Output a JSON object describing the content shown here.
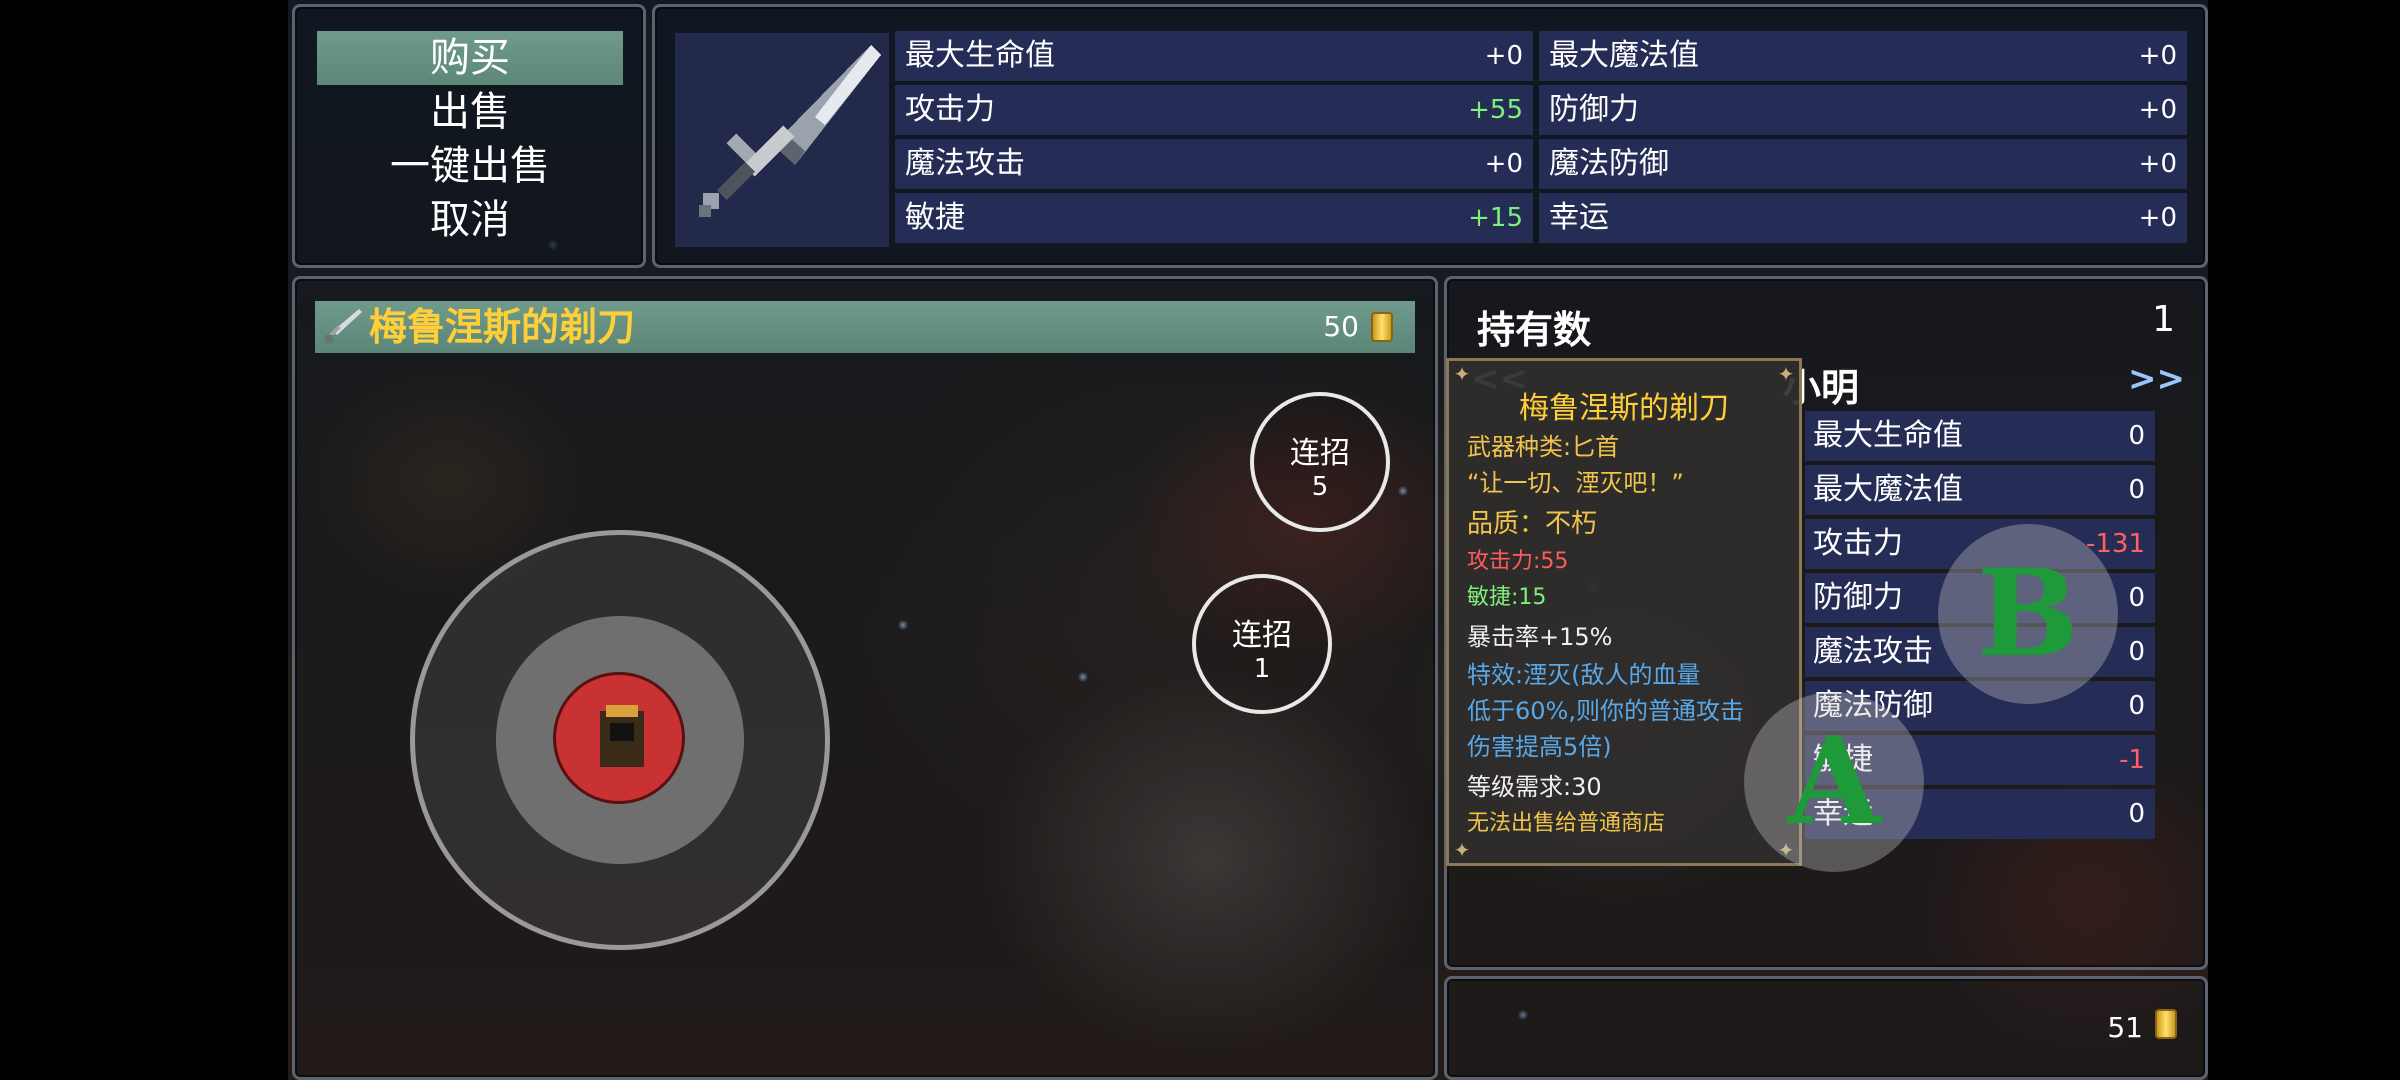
{
  "command_menu": {
    "items": [
      {
        "label": "购买",
        "selected": true
      },
      {
        "label": "出售",
        "selected": false
      },
      {
        "label": "一键出售",
        "selected": false
      },
      {
        "label": "取消",
        "selected": false
      }
    ]
  },
  "item_stats": {
    "icon": "dagger-icon",
    "rows": [
      {
        "label": "最大生命值",
        "value": "+0"
      },
      {
        "label": "最大魔法值",
        "value": "+0"
      },
      {
        "label": "攻击力",
        "value": "+55"
      },
      {
        "label": "防御力",
        "value": "+0"
      },
      {
        "label": "魔法攻击",
        "value": "+0"
      },
      {
        "label": "魔法防御",
        "value": "+0"
      },
      {
        "label": "敏捷",
        "value": "+15"
      },
      {
        "label": "幸运",
        "value": "+0"
      }
    ]
  },
  "item_list": {
    "selected_item": {
      "name": "梅鲁涅斯的剃刀",
      "price": "50",
      "icon": "dagger-icon"
    }
  },
  "combo_buttons": [
    {
      "label": "连招",
      "count": "5"
    },
    {
      "label": "连招",
      "count": "1"
    }
  ],
  "holdings": {
    "label": "持有数",
    "value": "1"
  },
  "actor": {
    "name": "小明",
    "prev": "<<",
    "next": ">>",
    "stats": [
      {
        "label": "最大生命值",
        "value": "0"
      },
      {
        "label": "最大魔法值",
        "value": "0"
      },
      {
        "label": "攻击力",
        "value": "-131"
      },
      {
        "label": "防御力",
        "value": "0"
      },
      {
        "label": "魔法攻击",
        "value": "0"
      },
      {
        "label": "魔法防御",
        "value": "0"
      },
      {
        "label": "敏捷",
        "value": "-1"
      },
      {
        "label": "幸运",
        "value": "0"
      }
    ]
  },
  "tooltip": {
    "title": "梅鲁涅斯的剃刀",
    "lines": [
      "武器种类:匕首",
      "“让一切、湮灭吧！”",
      "品质：不朽",
      "攻击力:55",
      "敏捷:15",
      "暴击率+15%",
      "特效:湮灭(敌人的血量",
      "低于60%,则你的普通攻击",
      "伤害提高5倍)",
      "等级需求:30",
      "无法出售给普通商店"
    ]
  },
  "action_buttons": {
    "a": "A",
    "b": "B"
  },
  "gold": {
    "value": "51",
    "icon": "coin-icon"
  },
  "colors": {
    "highlight": "#6f9a8c",
    "stat_cell": "#252c55",
    "item_name": "#ffcf3a",
    "positive": "#7ef07a",
    "negative": "#ff6060",
    "effect_text": "#58a8e8"
  }
}
